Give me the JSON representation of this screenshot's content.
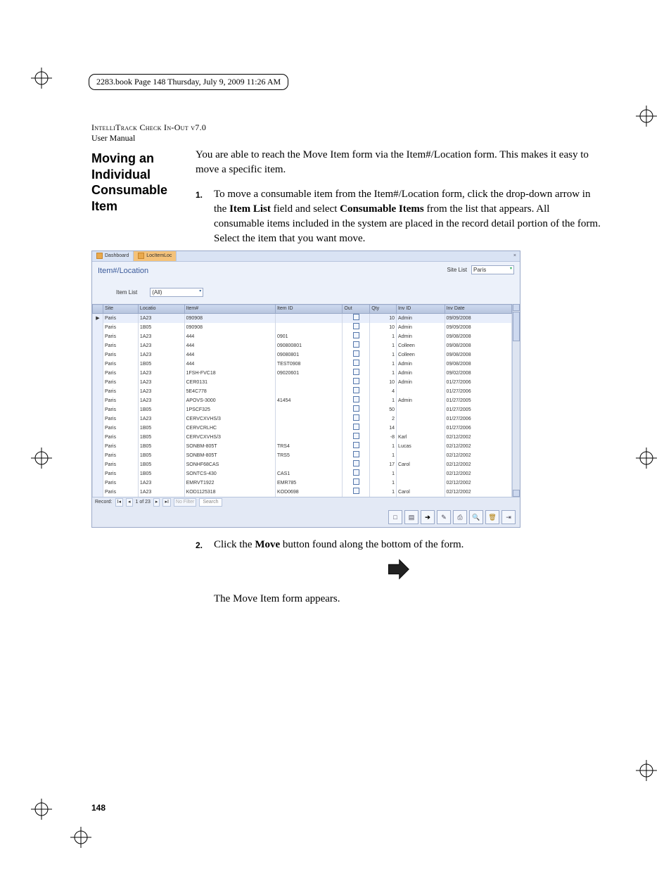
{
  "header": {
    "bookline": "2283.book  Page 148  Thursday, July 9, 2009  11:26 AM",
    "running_head": "IntelliTrack Check In-Out v7.0",
    "running_sub": "User Manual"
  },
  "sidehead": "Moving an Individual Consumable Item",
  "para1": "You are able to reach the Move Item form via the Item#/Location form. This makes it easy to move a specific item.",
  "step1": {
    "num": "1.",
    "a": "To move a consumable item from the Item#/Location form, click the drop-down arrow in the ",
    "b": "Item List",
    "c": " field and select ",
    "d": "Consumable Items",
    "e": " from the list that appears. All consumable items included in the system are placed in the record detail portion of the form. Select the item that you want move."
  },
  "step2": {
    "num": "2.",
    "a": "Click the ",
    "b": "Move",
    "c": " button found along the bottom of the form."
  },
  "para2": "The Move Item form appears.",
  "page_num": "148",
  "shot": {
    "tabs": {
      "dash": "Dashboard",
      "loc": "LocItemLoc"
    },
    "title": "Item#/Location",
    "site_label": "Site List",
    "site_value": "Paris",
    "itemlist_label": "Item List",
    "itemlist_value": "(All)",
    "cols": [
      "",
      "Site",
      "Locatio",
      "Item#",
      "Item ID",
      "Out",
      "Qty",
      "Inv ID",
      "Inv Date"
    ],
    "selected_marker": "▶",
    "rows": [
      [
        "Paris",
        "1A23",
        "090908",
        "",
        "",
        10,
        "Admin",
        "09/09/2008"
      ],
      [
        "Paris",
        "1B05",
        "090908",
        "",
        "",
        10,
        "Admin",
        "09/09/2008"
      ],
      [
        "Paris",
        "1A23",
        "444",
        "0901",
        "",
        1,
        "Admin",
        "09/08/2008"
      ],
      [
        "Paris",
        "1A23",
        "444",
        "090800801",
        "",
        1,
        "Colleen",
        "09/08/2008"
      ],
      [
        "Paris",
        "1A23",
        "444",
        "09080801",
        "",
        1,
        "Colleen",
        "09/08/2008"
      ],
      [
        "Paris",
        "1B05",
        "444",
        "TEST0908",
        "",
        1,
        "Admin",
        "09/08/2008"
      ],
      [
        "Paris",
        "1A23",
        "1FSH-FVC18",
        "09020601",
        "",
        1,
        "Admin",
        "09/02/2008"
      ],
      [
        "Paris",
        "1A23",
        "CER0131",
        "",
        "",
        10,
        "Admin",
        "01/27/2006"
      ],
      [
        "Paris",
        "1A23",
        "5E4C778",
        "",
        "",
        4,
        "",
        "01/27/2006"
      ],
      [
        "Paris",
        "1A23",
        "APOVS-3000",
        "41454",
        "",
        1,
        "Admin",
        "01/27/2005"
      ],
      [
        "Paris",
        "1B05",
        "1PSCF325",
        "",
        "",
        50,
        "",
        "01/27/2005"
      ],
      [
        "Paris",
        "1A23",
        "CERVCXVHS/3",
        "",
        "",
        2,
        "",
        "01/27/2006"
      ],
      [
        "Paris",
        "1B05",
        "CERVCRLHC",
        "",
        "",
        14,
        "",
        "01/27/2006"
      ],
      [
        "Paris",
        "1B05",
        "CERVCXVHS/3",
        "",
        "",
        -8,
        "Karl",
        "02/12/2002"
      ],
      [
        "Paris",
        "1B05",
        "SONBM-805T",
        "TRS4",
        "",
        1,
        "Lucas",
        "02/12/2002"
      ],
      [
        "Paris",
        "1B05",
        "SONBM-805T",
        "TRS5",
        "",
        1,
        "",
        "02/12/2002"
      ],
      [
        "Paris",
        "1B05",
        "SONHF68CAS",
        "",
        "",
        17,
        "Carol",
        "02/12/2002"
      ],
      [
        "Paris",
        "1B05",
        "SONTCS-430",
        "CAS1",
        "",
        1,
        "",
        "02/12/2002"
      ],
      [
        "Paris",
        "1A23",
        "EMRVT1922",
        "EMR785",
        "",
        1,
        "",
        "02/12/2002"
      ],
      [
        "Paris",
        "1A23",
        "KOD1125318",
        "KOD0698",
        "",
        1,
        "Carol",
        "02/12/2002"
      ]
    ],
    "recbar": {
      "label": "Record:",
      "first": "I◂",
      "prev": "◂",
      "pos": "1 of 23",
      "next": "▸",
      "last": "▸I",
      "nofilter": "No Filter",
      "search": "Search"
    },
    "toolbar": {
      "new": "□",
      "save": "▤",
      "move": "➔",
      "assign": "✎",
      "print": "⎙",
      "preview": "🔍",
      "delete": "🗑",
      "close": "⇥"
    }
  }
}
